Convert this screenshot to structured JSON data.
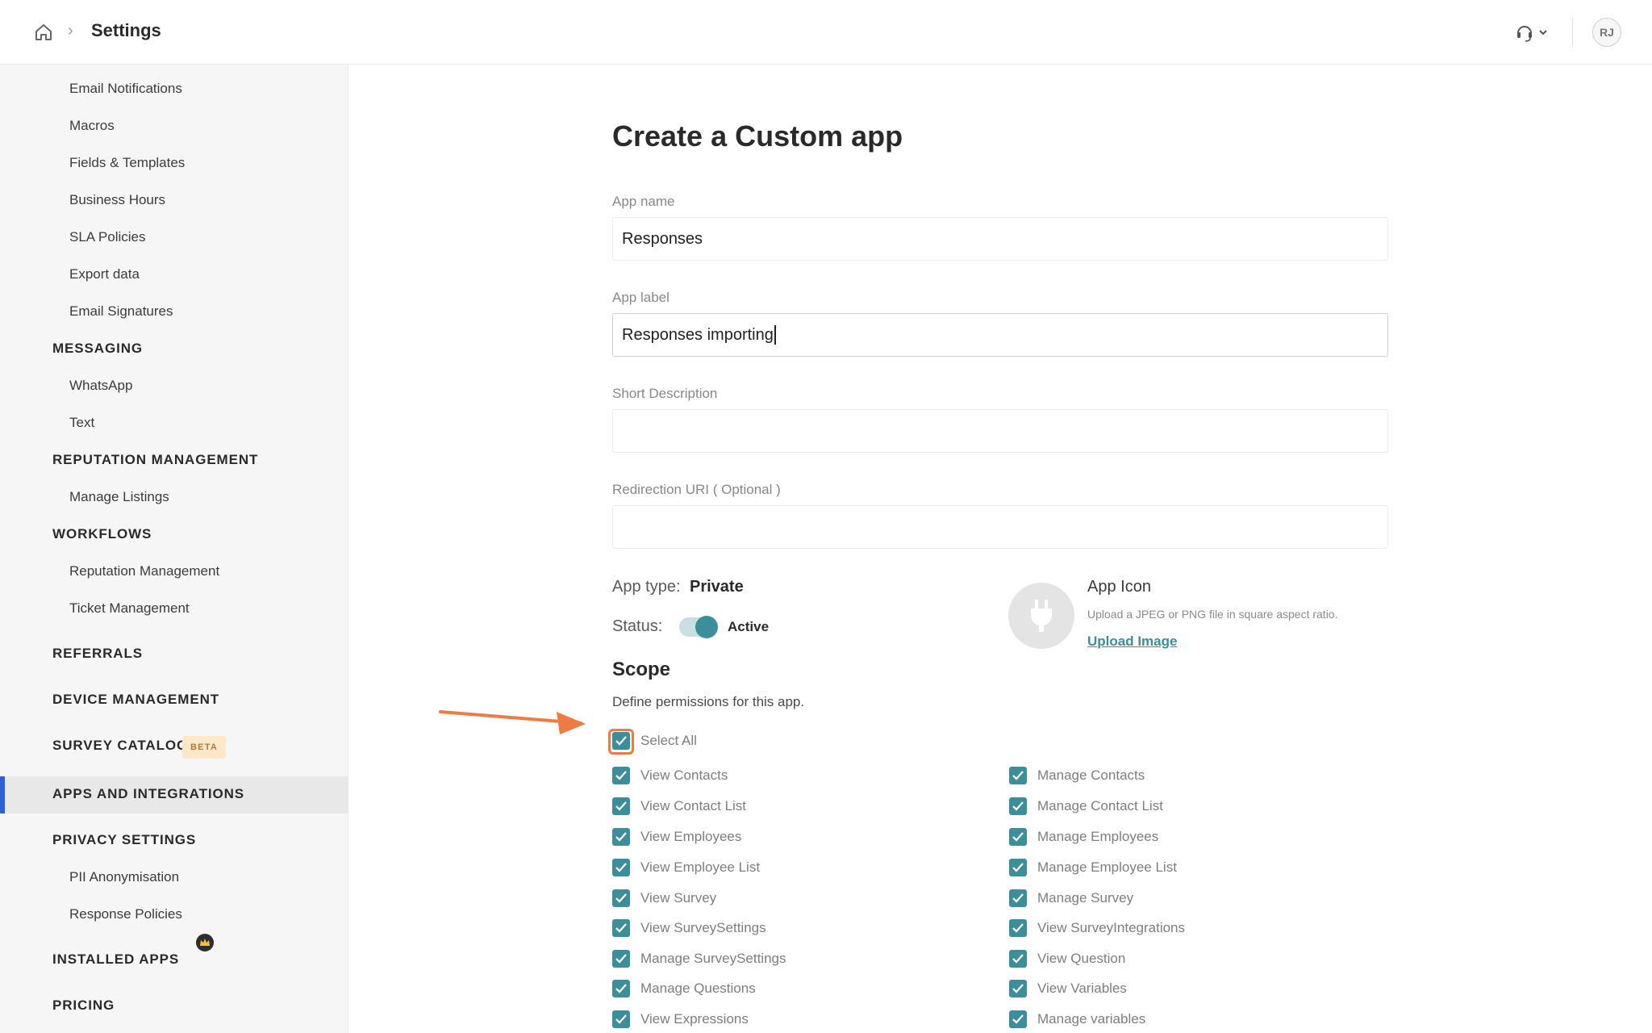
{
  "header": {
    "title": "Settings",
    "avatar_initials": "RJ"
  },
  "sidebar": {
    "items": [
      {
        "label": "Email Notifications",
        "type": "item"
      },
      {
        "label": "Macros",
        "type": "item"
      },
      {
        "label": "Fields & Templates",
        "type": "item"
      },
      {
        "label": "Business Hours",
        "type": "item"
      },
      {
        "label": "SLA Policies",
        "type": "item"
      },
      {
        "label": "Export data",
        "type": "item"
      },
      {
        "label": "Email Signatures",
        "type": "item"
      },
      {
        "label": "MESSAGING",
        "type": "heading"
      },
      {
        "label": "WhatsApp",
        "type": "item"
      },
      {
        "label": "Text",
        "type": "item"
      },
      {
        "label": "REPUTATION MANAGEMENT",
        "type": "heading"
      },
      {
        "label": "Manage Listings",
        "type": "item"
      },
      {
        "label": "WORKFLOWS",
        "type": "heading"
      },
      {
        "label": "Reputation Management",
        "type": "item"
      },
      {
        "label": "Ticket Management",
        "type": "item"
      },
      {
        "label": "REFERRALS",
        "type": "heading"
      },
      {
        "label": "DEVICE MANAGEMENT",
        "type": "heading"
      },
      {
        "label": "SURVEY CATALOG",
        "type": "heading"
      },
      {
        "label": "APPS AND INTEGRATIONS",
        "type": "heading",
        "active": true
      },
      {
        "label": "PRIVACY SETTINGS",
        "type": "heading"
      },
      {
        "label": "PII Anonymisation",
        "type": "item"
      },
      {
        "label": "Response Policies",
        "type": "item"
      },
      {
        "label": "INSTALLED APPS",
        "type": "heading"
      },
      {
        "label": "PRICING",
        "type": "heading"
      }
    ],
    "beta_badge": "BETA"
  },
  "form": {
    "title": "Create a Custom app",
    "app_name": {
      "label": "App name",
      "value": "Responses"
    },
    "app_label": {
      "label": "App label",
      "value": "Responses importing"
    },
    "short_description": {
      "label": "Short Description",
      "value": ""
    },
    "redirection_uri": {
      "label": "Redirection URI ( Optional )",
      "value": ""
    },
    "app_type": {
      "label": "App type:",
      "value": "Private"
    },
    "status": {
      "label": "Status:",
      "value": "Active",
      "enabled": true
    },
    "app_icon": {
      "title": "App Icon",
      "hint": "Upload a JPEG or PNG file in square aspect ratio.",
      "upload_label": "Upload Image"
    }
  },
  "scope": {
    "title": "Scope",
    "description": "Define permissions for this app.",
    "select_all": {
      "label": "Select All",
      "checked": true
    },
    "left_permissions": [
      {
        "label": "View Contacts",
        "checked": true
      },
      {
        "label": "View Contact List",
        "checked": true
      },
      {
        "label": "View Employees",
        "checked": true
      },
      {
        "label": "View Employee List",
        "checked": true
      },
      {
        "label": "View Survey",
        "checked": true
      },
      {
        "label": "View SurveySettings",
        "checked": true
      },
      {
        "label": "Manage SurveySettings",
        "checked": true
      },
      {
        "label": "Manage Questions",
        "checked": true
      },
      {
        "label": "View Expressions",
        "checked": true
      }
    ],
    "right_permissions": [
      {
        "label": "Manage Contacts",
        "checked": true
      },
      {
        "label": "Manage Contact List",
        "checked": true
      },
      {
        "label": "Manage Employees",
        "checked": true
      },
      {
        "label": "Manage Employee List",
        "checked": true
      },
      {
        "label": "Manage Survey",
        "checked": true
      },
      {
        "label": "View SurveyIntegrations",
        "checked": true
      },
      {
        "label": "View Question",
        "checked": true
      },
      {
        "label": "View Variables",
        "checked": true
      },
      {
        "label": "Manage variables",
        "checked": true
      }
    ]
  },
  "colors": {
    "accent": "#3d8e9b",
    "active_nav_bar": "#2d5fd7",
    "annotation_arrow": "#f07a44"
  }
}
